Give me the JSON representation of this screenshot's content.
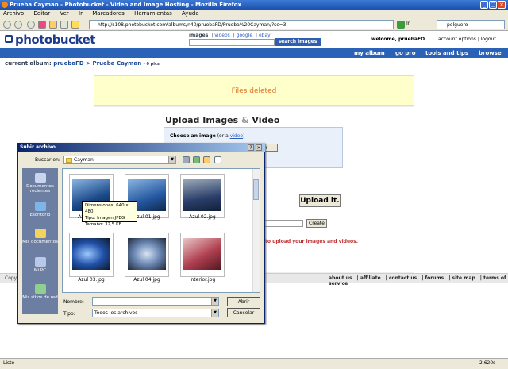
{
  "window": {
    "title": "Prueba Cayman - Photobucket - Video and Image Hosting - Mozilla Firefox"
  },
  "menu": [
    "Archivo",
    "Editar",
    "Ver",
    "Ir",
    "Marcadores",
    "Herramientas",
    "Ayuda"
  ],
  "nav": {
    "url": "http://s108.photobucket.com/albums/n40/pruebaFD/Prueba%20Cayman/?sc=3",
    "go": "Ir",
    "search_value": "pelguero"
  },
  "site": {
    "logo": "photobucket",
    "search_tabs": [
      "images",
      "videos",
      "google",
      "ebay"
    ],
    "search_button": "search images",
    "welcome": "welcome, pruebaFD",
    "account_links": "account options  |  logout",
    "nav": [
      "my album",
      "go pro",
      "tools and tips",
      "browse"
    ]
  },
  "album": {
    "prefix": "current album:",
    "user": "pruebaFD",
    "sep": ">",
    "name": "Prueba Cayman",
    "count": "- 0 pics"
  },
  "notice": "Files deleted",
  "upload": {
    "heading_a": "Upload Images",
    "heading_amp": "&",
    "heading_b": "Video",
    "choose_prefix": "Choose an image",
    "choose_mid": "(or a",
    "choose_link": "video",
    "browse_partial": "ar",
    "upload_button": "Upload it.",
    "create_button": "Create",
    "promo": "to upload your images and videos."
  },
  "footer": {
    "copy": "Copy",
    "links": [
      "about us",
      "affiliate",
      "contact us",
      "forums",
      "site map",
      "terms of service"
    ]
  },
  "status": {
    "left": "Listo",
    "right": "2.620s"
  },
  "dialog": {
    "title": "Subir archivo",
    "lookin_label": "Buscar en:",
    "lookin_value": "Cayman",
    "places": [
      "Documentos recientes",
      "Escritorio",
      "Mis documentos",
      "Mi PC",
      "Mis sitios de red"
    ],
    "files": [
      "Azul 00.jpg",
      "Azul 01.jpg",
      "Azul 02.jpg",
      "Azul 03.jpg",
      "Azul 04.jpg",
      "Interior.jpg"
    ],
    "tooltip": [
      "Dimensiones: 640 x 480",
      "Tipo: Imagen JPEG",
      "Tamaño: 32,5 KB"
    ],
    "name_label": "Nombre:",
    "type_label": "Tipo:",
    "type_value": "Todos los archivos",
    "open_button": "Abrir",
    "cancel_button": "Cancelar"
  }
}
